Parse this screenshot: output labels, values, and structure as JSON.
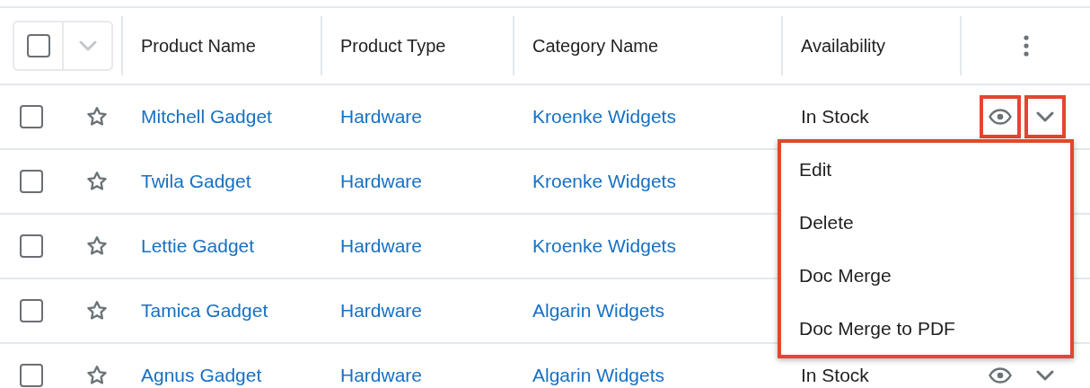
{
  "header": {
    "select_all_checked": false,
    "columns": [
      "Product Name",
      "Product Type",
      "Category Name",
      "Availability"
    ]
  },
  "rows": [
    {
      "checked": false,
      "favorite": false,
      "name": "Mitchell Gadget",
      "type": "Hardware",
      "category": "Kroenke Widgets",
      "availability": "In Stock",
      "actions": {
        "highlighted": true
      }
    },
    {
      "checked": false,
      "favorite": false,
      "name": "Twila Gadget",
      "type": "Hardware",
      "category": "Kroenke Widgets"
    },
    {
      "checked": false,
      "favorite": false,
      "name": "Lettie Gadget",
      "type": "Hardware",
      "category": "Kroenke Widgets"
    },
    {
      "checked": false,
      "favorite": false,
      "name": "Tamica Gadget",
      "type": "Hardware",
      "category": "Algarin Widgets"
    },
    {
      "checked": false,
      "favorite": false,
      "name": "Agnus Gadget",
      "type": "Hardware",
      "category": "Algarin Widgets",
      "availability": "In Stock",
      "actions": {
        "highlighted": false
      }
    }
  ],
  "menu": {
    "highlighted": true,
    "items": [
      "Edit",
      "Delete",
      "Doc Merge",
      "Doc Merge to PDF"
    ]
  }
}
